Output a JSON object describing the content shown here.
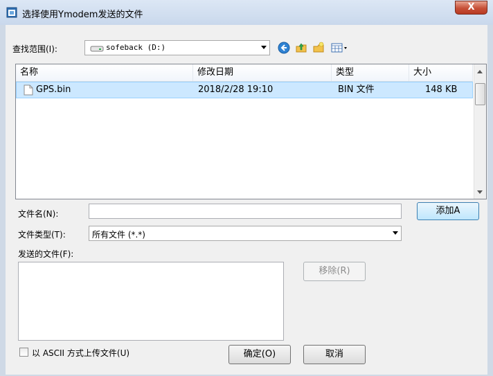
{
  "window": {
    "title": "选择使用Ymodem发送的文件",
    "close_label": "X"
  },
  "lookin": {
    "label": "查找范围(I):",
    "value": "sofeback (D:)"
  },
  "columns": [
    "名称",
    "修改日期",
    "类型",
    "大小"
  ],
  "files": [
    {
      "name": "GPS.bin",
      "modified": "2018/2/28 19:10",
      "type": "BIN 文件",
      "size": "148 KB"
    }
  ],
  "filename": {
    "label": "文件名(N):",
    "value": ""
  },
  "filetype": {
    "label": "文件类型(T):",
    "value": "所有文件 (*.*)"
  },
  "add_button": "添加A",
  "send_list_label": "发送的文件(F):",
  "remove_button": "移除(R)",
  "ascii_checkbox": {
    "label": "以 ASCII 方式上传文件(U)",
    "checked": false
  },
  "ok_button": "确定(O)",
  "cancel_button": "取消",
  "icons": {
    "back": "back-icon",
    "up": "up-folder-icon",
    "new_folder": "new-folder-icon",
    "view": "view-menu-icon",
    "drive": "drive-icon",
    "file": "file-icon",
    "app": "app-icon"
  }
}
